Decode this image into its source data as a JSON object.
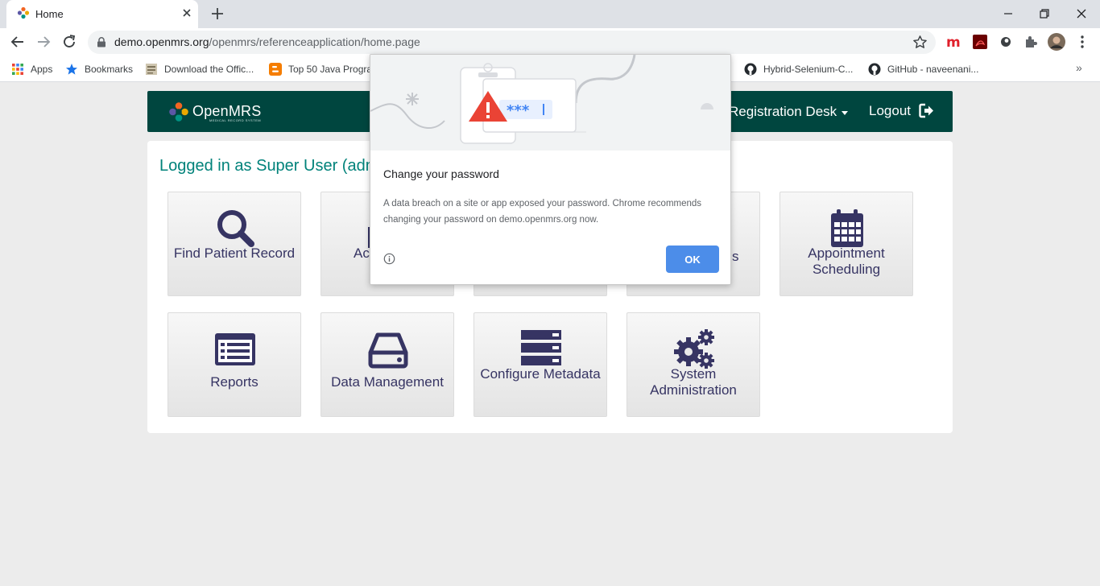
{
  "browser": {
    "tab": {
      "title": "Home"
    },
    "address_bar": {
      "host": "demo.openmrs.org",
      "path": "/openmrs/referenceapplication/home.page"
    },
    "bookmarks": [
      {
        "label": "Apps",
        "icon": "apps-grid-icon"
      },
      {
        "label": "Bookmarks",
        "icon": "star-icon"
      },
      {
        "label": "Download the Offic...",
        "icon": "document-icon"
      },
      {
        "label": "Top 50 Java Progra...",
        "icon": "blogger-icon"
      },
      {
        "label": "Hybrid-Selenium-C...",
        "icon": "github-icon"
      },
      {
        "label": "GitHub - naveenani...",
        "icon": "github-icon"
      }
    ],
    "bookmarks_overflow": "»"
  },
  "header": {
    "logo_text": "OpenMRS",
    "logo_subtext": "MEDICAL RECORD SYSTEM",
    "location": "Registration Desk",
    "logout": "Logout"
  },
  "main": {
    "logged_in_text": "Logged in as Super User (adm",
    "apps": [
      {
        "label": "Find Patient Record",
        "icon": "search-icon"
      },
      {
        "label": "Act",
        "icon": "activity-icon"
      },
      {
        "label": "",
        "icon": ""
      },
      {
        "label": "s",
        "icon": ""
      },
      {
        "label": "Appointment Scheduling",
        "icon": "calendar-icon"
      },
      {
        "label": "Reports",
        "icon": "report-list-icon"
      },
      {
        "label": "Data Management",
        "icon": "hard-drive-icon"
      },
      {
        "label": "Configure Metadata",
        "icon": "server-stack-icon"
      },
      {
        "label": "System Administration",
        "icon": "gears-icon"
      }
    ]
  },
  "dialog": {
    "title": "Change your password",
    "message": "A data breach on a site or app exposed your password. Chrome recommends changing your password on demo.openmrs.org now.",
    "masked_password": "***",
    "ok_label": "OK"
  },
  "colors": {
    "header_bg": "#00463f",
    "logged_in_text": "#00827a",
    "tile_text": "#363463",
    "ok_button": "#4c8de9",
    "warning_red": "#ea4335"
  }
}
